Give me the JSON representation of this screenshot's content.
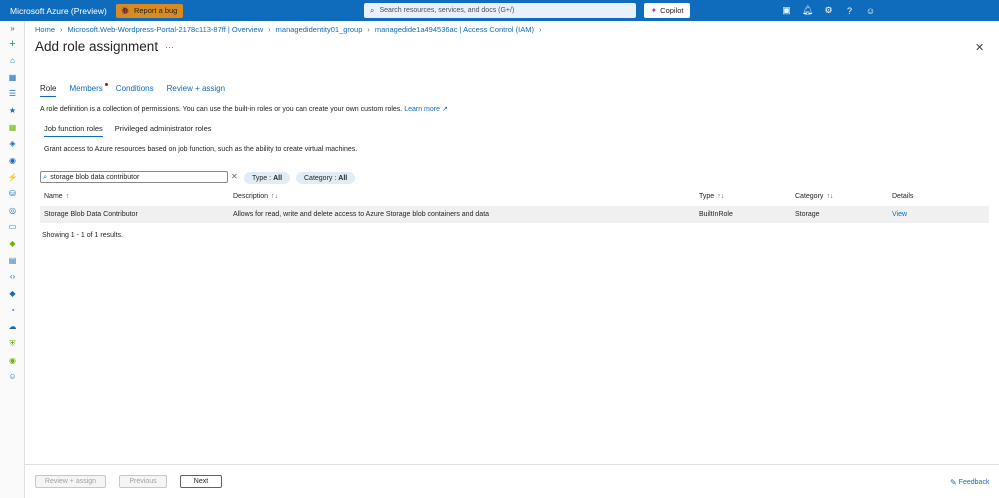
{
  "header": {
    "brand": "Microsoft Azure (Preview)",
    "report_bug": "Report a bug",
    "search_placeholder": "Search resources, services, and docs (G+/)",
    "copilot": "Copilot"
  },
  "breadcrumb": {
    "home": "Home",
    "item1": "Microsoft.Web-Wordpress-Portal-2178c113-87ff | Overview",
    "item2": "managedidentity01_group",
    "item3": "managedide1a494536ac | Access Control (IAM)"
  },
  "page": {
    "title": "Add role assignment",
    "more": "···"
  },
  "tabs": {
    "role": "Role",
    "members": "Members",
    "conditions": "Conditions",
    "review": "Review + assign"
  },
  "intro": {
    "text": "A role definition is a collection of permissions. You can use the built-in roles or you can create your own custom roles.",
    "learn_more": "Learn more"
  },
  "subtabs": {
    "job": "Job function roles",
    "privileged": "Privileged administrator roles"
  },
  "grant_text": "Grant access to Azure resources based on job function, such as the ability to create virtual machines.",
  "filter": {
    "value": "storage blob data contributor",
    "type_label": "Type :",
    "type_value": "All",
    "category_label": "Category :",
    "category_value": "All"
  },
  "table": {
    "headers": {
      "name": "Name",
      "description": "Description",
      "type": "Type",
      "category": "Category",
      "details": "Details"
    },
    "rows": [
      {
        "name": "Storage Blob Data Contributor",
        "description": "Allows for read, write and delete access to Azure Storage blob containers and data",
        "type": "BuiltInRole",
        "category": "Storage",
        "details": "View"
      }
    ]
  },
  "showing": "Showing 1 - 1 of 1 results.",
  "footer": {
    "review": "Review + assign",
    "previous": "Previous",
    "next": "Next",
    "feedback": "Feedback"
  },
  "colors": {
    "topbar": "#0f6cbd",
    "link": "#0f6cbd",
    "bug": "#d98b1f"
  }
}
